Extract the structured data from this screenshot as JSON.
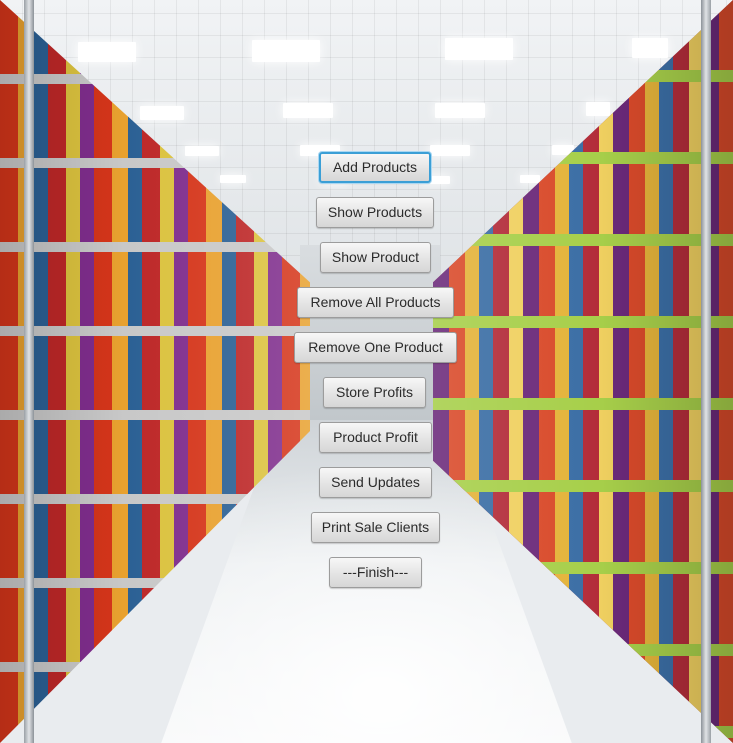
{
  "buttons": {
    "add_products": "Add Products",
    "show_products": "Show Products",
    "show_product": "Show Product",
    "remove_all_products": "Remove All Products",
    "remove_one_product": "Remove One Product",
    "store_profits": "Store Profits",
    "product_profit": "Product Profit",
    "send_updates": "Send Updates",
    "print_sale_clients": "Print Sale Clients",
    "finish": "---Finish---"
  },
  "focused_button": "Add Products",
  "background": {
    "scene": "supermarket-aisle-photo"
  },
  "colors": {
    "focus_ring": "#3b9fd6",
    "button_face": "#e4e4e4",
    "button_text": "#2b2b2b"
  }
}
